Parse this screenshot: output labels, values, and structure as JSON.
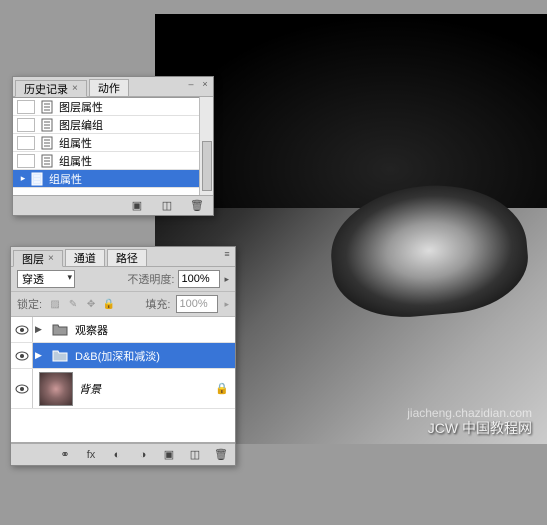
{
  "canvas": {
    "watermark_main": "JCW 中国教程网",
    "watermark_sub": "jiacheng.chazidian.com"
  },
  "history": {
    "tabs": [
      {
        "label": "历史记录",
        "active": true,
        "closable": true
      },
      {
        "label": "动作",
        "active": false,
        "closable": false
      }
    ],
    "items": [
      {
        "label": "图层属性",
        "selected": false
      },
      {
        "label": "图层编组",
        "selected": false
      },
      {
        "label": "组属性",
        "selected": false
      },
      {
        "label": "组属性",
        "selected": false
      },
      {
        "label": "组属性",
        "selected": true
      }
    ],
    "footer_icons": [
      "snapshot-icon",
      "new-state-icon",
      "trash-icon"
    ]
  },
  "layers": {
    "tabs": [
      {
        "label": "图层",
        "active": true,
        "closable": true
      },
      {
        "label": "通道",
        "active": false,
        "closable": false
      },
      {
        "label": "路径",
        "active": false,
        "closable": false
      }
    ],
    "blend_mode": "穿透",
    "opacity_label": "不透明度:",
    "opacity_value": "100%",
    "lock_label": "锁定:",
    "fill_label": "填充:",
    "fill_value": "100%",
    "items": [
      {
        "type": "group",
        "name": "观察器",
        "selected": false,
        "visible": true
      },
      {
        "type": "group",
        "name": "D&B(加深和减淡)",
        "selected": true,
        "visible": true
      },
      {
        "type": "layer",
        "name": "背景",
        "selected": false,
        "visible": true,
        "locked": true
      }
    ],
    "footer_icons": [
      "fx-icon",
      "mask-icon",
      "adjust-icon",
      "folder-icon",
      "new-layer-icon",
      "trash-icon"
    ]
  }
}
